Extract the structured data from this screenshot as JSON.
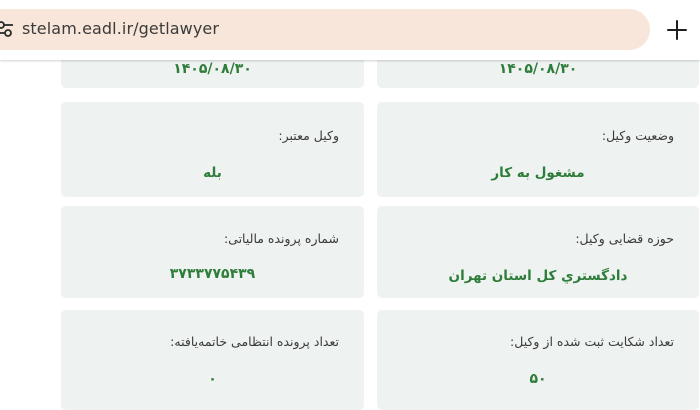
{
  "browser": {
    "url": "stelam.eadl.ir/getlawyer",
    "site_icon": "tune-icon",
    "new_tab_icon": "plus-icon"
  },
  "cards": {
    "top_right": {
      "value": "۱۴۰۵/۰۸/۳۰"
    },
    "top_left": {
      "value": "۱۴۰۵/۰۸/۳۰"
    },
    "lawyer_status": {
      "label": "وضعیت وکیل:",
      "value": "مشغول به کار"
    },
    "valid_lawyer": {
      "label": "وکیل معتبر:",
      "value": "بله"
    },
    "judicial_area": {
      "label": "حوزه قضایی وکیل:",
      "value": "دادگستري كل استان تهران"
    },
    "tax_file": {
      "label": "شماره پرونده مالیاتی:",
      "value": "۳۷۳۳۷۷۵۴۳۹"
    },
    "complaints": {
      "label": "تعداد شکایت ثبت شده از وکیل:",
      "value": "۵۰"
    },
    "disciplinary": {
      "label": "تعداد پرونده انتظامی خاتمه‌یافته:",
      "value": "۰"
    }
  },
  "colors": {
    "value_green": "#2f7d3a",
    "card_bg": "#eef2f0",
    "url_pill": "#f7e6d9"
  }
}
